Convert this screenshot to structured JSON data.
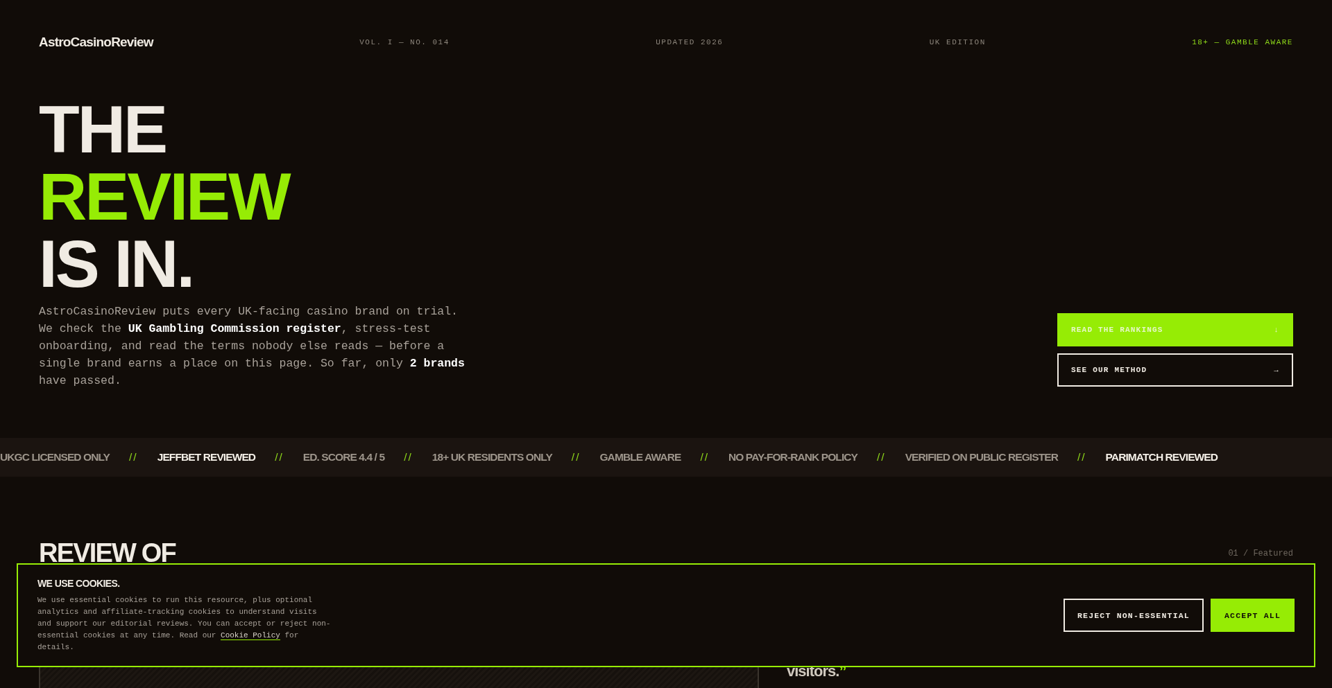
{
  "header": {
    "logo": "AstroCasinoReview",
    "meta": [
      "VOL. I — NO. 014",
      "UPDATED 2026",
      "UK EDITION"
    ],
    "badge": "18+ — GAMBLE AWARE"
  },
  "hero": {
    "title_lines": [
      {
        "text": "THE",
        "accent": false
      },
      {
        "text": "REVIEW",
        "accent": true
      },
      {
        "text": "IS IN.",
        "accent": false
      }
    ],
    "intro": "AstroCasinoReview puts every UK-facing casino brand on trial. We check the **UK Gambling Commission register**, stress-test onboarding, and read the terms nobody else reads — before a single brand earns a place on this page. So far, only **2 brands** have passed.",
    "buttons": [
      {
        "label": "READ THE RANKINGS",
        "icon": "↓",
        "kind": "primary"
      },
      {
        "label": "SEE OUR METHOD",
        "icon": "→",
        "kind": "outline"
      }
    ]
  },
  "ticker": {
    "separator": "//",
    "items": [
      {
        "text": "UKGC LICENSED ONLY",
        "highlighted": false
      },
      {
        "text": "JEFFBET REVIEWED",
        "highlighted": true
      },
      {
        "text": "ED. SCORE 4.4 / 5",
        "highlighted": false
      },
      {
        "text": "18+ UK RESIDENTS ONLY",
        "highlighted": false
      },
      {
        "text": "GAMBLE AWARE",
        "highlighted": false
      },
      {
        "text": "NO PAY-FOR-RANK POLICY",
        "highlighted": false
      },
      {
        "text": "VERIFIED ON PUBLIC REGISTER",
        "highlighted": false
      },
      {
        "text": "PARIMATCH REVIEWED",
        "highlighted": true
      }
    ]
  },
  "section": {
    "heading": "REVIEW OF",
    "label": "01 / Featured",
    "quote_end": "visitors.",
    "quote_mark": "”"
  },
  "cookie_banner": {
    "title": "WE USE COOKIES.",
    "text": "We use essential cookies to run this resource, plus optional analytics and affiliate-tracking cookies to understand visits and support our editorial reviews. You can accept or reject non-essential cookies at any time. Read our",
    "link": "Cookie Policy",
    "text_end": "for details.",
    "buttons": [
      {
        "label": "REJECT NON-ESSENTIAL",
        "kind": "outline"
      },
      {
        "label": "ACCEPT ALL",
        "kind": "primary"
      }
    ]
  }
}
